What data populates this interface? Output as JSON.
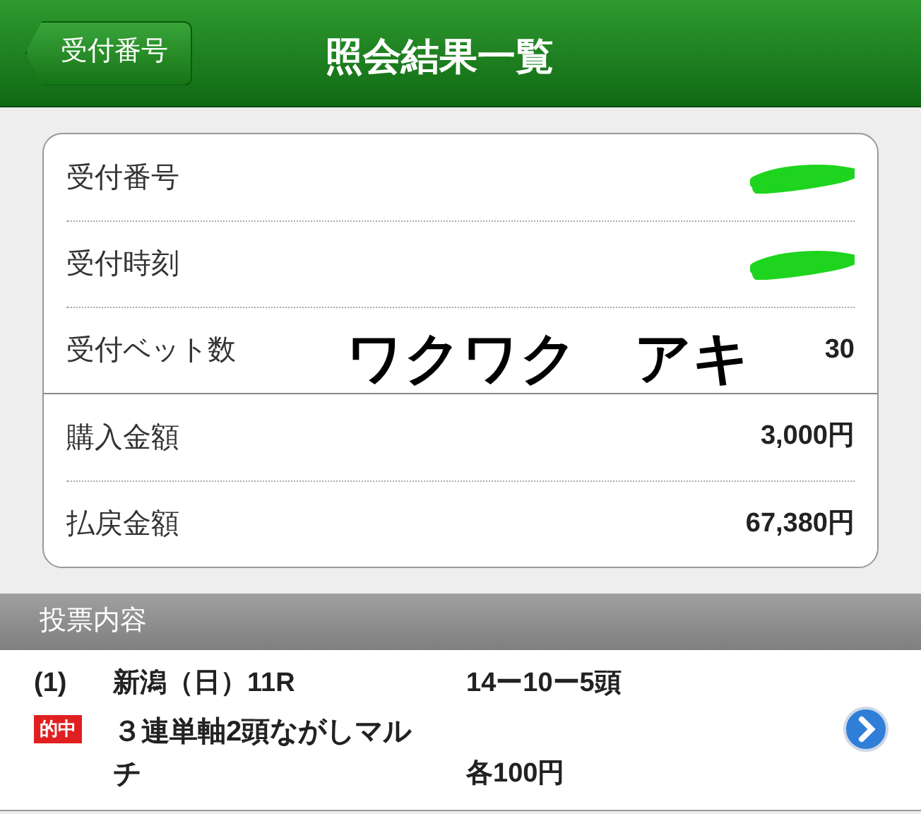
{
  "nav": {
    "back": "受付番号",
    "title": "照会結果一覧"
  },
  "summary": {
    "groups": [
      [
        {
          "label": "受付番号",
          "redacted": true
        },
        {
          "label": "受付時刻",
          "redacted": true
        },
        {
          "label": "受付ベット数",
          "value": "30",
          "redacted": false
        }
      ],
      [
        {
          "label": "購入金額",
          "value": "3,000円",
          "redacted": false
        },
        {
          "label": "払戻金額",
          "value": "67,380円",
          "redacted": false
        }
      ]
    ]
  },
  "overlay_caption": "ワクワク　アキ",
  "section": {
    "title": "投票内容"
  },
  "bets": [
    {
      "index": "(1)",
      "race": "新潟（日）11R",
      "horses": "14ー10ー5頭",
      "won": true,
      "result": "的中",
      "type": "３連単軸2頭ながしマルチ",
      "amount": "各100円"
    }
  ]
}
